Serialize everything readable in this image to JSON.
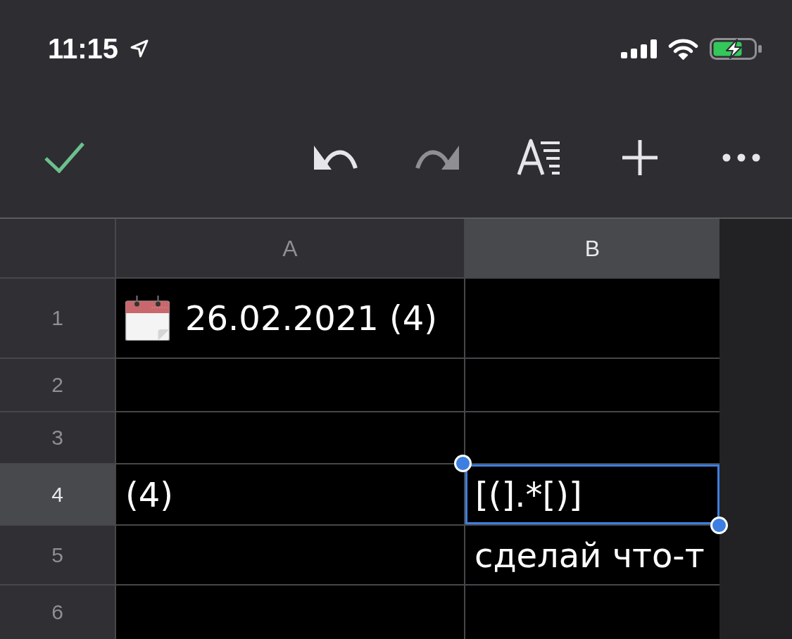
{
  "status_bar": {
    "time": "11:15",
    "battery_charging": true
  },
  "toolbar": [
    {
      "kind": "done",
      "disabled": false
    },
    {
      "kind": "undo",
      "disabled": false
    },
    {
      "kind": "redo",
      "disabled": true
    },
    {
      "kind": "format",
      "disabled": false
    },
    {
      "kind": "insert",
      "disabled": false
    },
    {
      "kind": "more",
      "disabled": false
    }
  ],
  "sheet": {
    "columns": [
      {
        "label": "A",
        "selected": false
      },
      {
        "label": "B",
        "selected": true
      }
    ],
    "rows": [
      {
        "label": "1",
        "selected": false,
        "cells": [
          {
            "kind": "date",
            "text": "26.02.2021 (4)",
            "selected": false
          },
          {
            "kind": "empty",
            "selected": false
          }
        ]
      },
      {
        "label": "2",
        "selected": false,
        "cells": [
          {
            "kind": "empty",
            "selected": false
          },
          {
            "kind": "empty",
            "selected": false
          }
        ]
      },
      {
        "label": "3",
        "selected": false,
        "cells": [
          {
            "kind": "empty",
            "selected": false
          },
          {
            "kind": "empty",
            "selected": false
          }
        ]
      },
      {
        "label": "4",
        "selected": true,
        "cells": [
          {
            "kind": "text",
            "text": "(4)",
            "selected": false
          },
          {
            "kind": "text",
            "text": "[(].*[)]",
            "selected": true
          }
        ]
      },
      {
        "label": "5",
        "selected": false,
        "cells": [
          {
            "kind": "empty",
            "selected": false
          },
          {
            "kind": "text",
            "text": "сделай что-т",
            "selected": false
          }
        ]
      },
      {
        "label": "6",
        "selected": false,
        "cells": [
          {
            "kind": "empty",
            "selected": false
          },
          {
            "kind": "empty",
            "selected": false
          }
        ]
      }
    ]
  }
}
